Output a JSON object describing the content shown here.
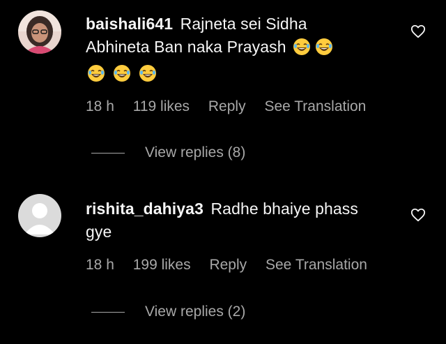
{
  "comments": [
    {
      "username": "baishali641",
      "text_line1": "Rajneta sei Sidha",
      "text_line2": "Abhineta Ban naka Prayash",
      "emoji": "grinning-squinting-sweat-face",
      "time": "18 h",
      "likes": "119 likes",
      "reply_label": "Reply",
      "translate_label": "See Translation",
      "view_replies": "View replies (8)"
    },
    {
      "username": "rishita_dahiya3",
      "text_line1": "Radhe bhaiye phass",
      "text_line2": "gye",
      "time": "18 h",
      "likes": "199 likes",
      "reply_label": "Reply",
      "translate_label": "See Translation",
      "view_replies": "View replies (2)"
    }
  ],
  "colors": {
    "background": "#000000",
    "text": "#f5f5f5",
    "secondary": "#a8a8a8"
  }
}
